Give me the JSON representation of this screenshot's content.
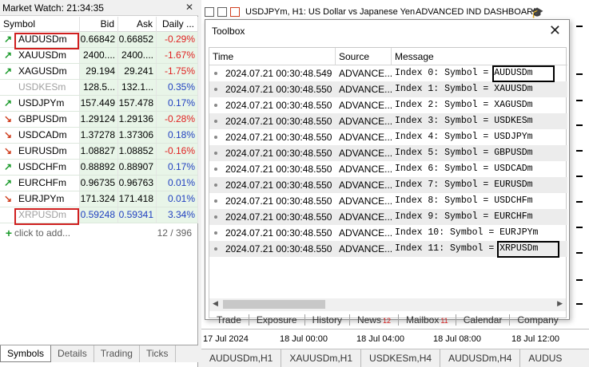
{
  "market_watch": {
    "title": "Market Watch: 21:34:35",
    "columns": [
      "Symbol",
      "Bid",
      "Ask",
      "Daily ..."
    ],
    "rows": [
      {
        "symbol": "AUDUSDm",
        "bid": "0.66842",
        "ask": "0.66852",
        "daily": "-0.29%",
        "dir": "up"
      },
      {
        "symbol": "XAUUSDm",
        "bid": "2400....",
        "ask": "2400....",
        "daily": "-1.67%",
        "dir": "up"
      },
      {
        "symbol": "XAGUSDm",
        "bid": "29.194",
        "ask": "29.241",
        "daily": "-1.75%",
        "dir": "up"
      },
      {
        "symbol": "USDKESm",
        "bid": "128.5...",
        "ask": "132.1...",
        "daily": "0.35%",
        "dir": "none"
      },
      {
        "symbol": "USDJPYm",
        "bid": "157.449",
        "ask": "157.478",
        "daily": "0.17%",
        "dir": "up"
      },
      {
        "symbol": "GBPUSDm",
        "bid": "1.29124",
        "ask": "1.29136",
        "daily": "-0.28%",
        "dir": "down"
      },
      {
        "symbol": "USDCADm",
        "bid": "1.37278",
        "ask": "1.37306",
        "daily": "0.18%",
        "dir": "down"
      },
      {
        "symbol": "EURUSDm",
        "bid": "1.08827",
        "ask": "1.08852",
        "daily": "-0.16%",
        "dir": "down"
      },
      {
        "symbol": "USDCHFm",
        "bid": "0.88892",
        "ask": "0.88907",
        "daily": "0.17%",
        "dir": "up"
      },
      {
        "symbol": "EURCHFm",
        "bid": "0.96735",
        "ask": "0.96763",
        "daily": "0.01%",
        "dir": "up"
      },
      {
        "symbol": "EURJPYm",
        "bid": "171.324",
        "ask": "171.418",
        "daily": "0.01%",
        "dir": "down"
      },
      {
        "symbol": "XRPUSDm",
        "bid": "0.59248",
        "ask": "0.59341",
        "daily": "3.34%",
        "dir": "none"
      }
    ],
    "add_label": "click to add...",
    "count": "12 / 396",
    "tabs": [
      "Symbols",
      "Details",
      "Trading",
      "Ticks"
    ],
    "active_tab": "Symbols",
    "colors": {
      "negative": "#e02020",
      "positive": "#2040c0",
      "up_arrow": "#1a9a2a",
      "down_arrow": "#d04020",
      "highlight_box": "#d02020"
    }
  },
  "chart": {
    "title": "USDJPYm, H1:  US Dollar vs Japanese Yen",
    "indicator": "ADVANCED IND DASHBOARD",
    "dates": [
      "17 Jul 2024",
      "18 Jul 00:00",
      "18 Jul 04:00",
      "18 Jul 08:00",
      "18 Jul 12:00"
    ],
    "tabs": [
      "AUDUSDm,H1",
      "XAUUSDm,H1",
      "USDKESm,H4",
      "AUDUSDm,H4",
      "AUDUS"
    ]
  },
  "toolbox": {
    "title": "Toolbox",
    "columns": [
      "Time",
      "Source",
      "Message"
    ],
    "rows": [
      {
        "time": "2024.07.21 00:30:48.549",
        "source": "ADVANCE...",
        "message": "Index 0: Symbol = ",
        "symbol": "AUDUSDm"
      },
      {
        "time": "2024.07.21 00:30:48.550",
        "source": "ADVANCE...",
        "message": "Index 1: Symbol = ",
        "symbol": "XAUUSDm"
      },
      {
        "time": "2024.07.21 00:30:48.550",
        "source": "ADVANCE...",
        "message": "Index 2: Symbol = ",
        "symbol": "XAGUSDm"
      },
      {
        "time": "2024.07.21 00:30:48.550",
        "source": "ADVANCE...",
        "message": "Index 3: Symbol = ",
        "symbol": "USDKESm"
      },
      {
        "time": "2024.07.21 00:30:48.550",
        "source": "ADVANCE...",
        "message": "Index 4: Symbol = ",
        "symbol": "USDJPYm"
      },
      {
        "time": "2024.07.21 00:30:48.550",
        "source": "ADVANCE...",
        "message": "Index 5: Symbol = ",
        "symbol": "GBPUSDm"
      },
      {
        "time": "2024.07.21 00:30:48.550",
        "source": "ADVANCE...",
        "message": "Index 6: Symbol = ",
        "symbol": "USDCADm"
      },
      {
        "time": "2024.07.21 00:30:48.550",
        "source": "ADVANCE...",
        "message": "Index 7: Symbol = ",
        "symbol": "EURUSDm"
      },
      {
        "time": "2024.07.21 00:30:48.550",
        "source": "ADVANCE...",
        "message": "Index 8: Symbol = ",
        "symbol": "USDCHFm"
      },
      {
        "time": "2024.07.21 00:30:48.550",
        "source": "ADVANCE...",
        "message": "Index 9: Symbol = ",
        "symbol": "EURCHFm"
      },
      {
        "time": "2024.07.21 00:30:48.550",
        "source": "ADVANCE...",
        "message": "Index 10: Symbol = ",
        "symbol": "EURJPYm"
      },
      {
        "time": "2024.07.21 00:30:48.550",
        "source": "ADVANCE...",
        "message": "Index 11: Symbol = ",
        "symbol": "XRPUSDm"
      }
    ],
    "tabs": [
      {
        "label": "Trade",
        "badge": ""
      },
      {
        "label": "Exposure",
        "badge": ""
      },
      {
        "label": "History",
        "badge": ""
      },
      {
        "label": "News",
        "badge": "12"
      },
      {
        "label": "Mailbox",
        "badge": "11"
      },
      {
        "label": "Calendar",
        "badge": ""
      },
      {
        "label": "Company",
        "badge": ""
      }
    ]
  }
}
